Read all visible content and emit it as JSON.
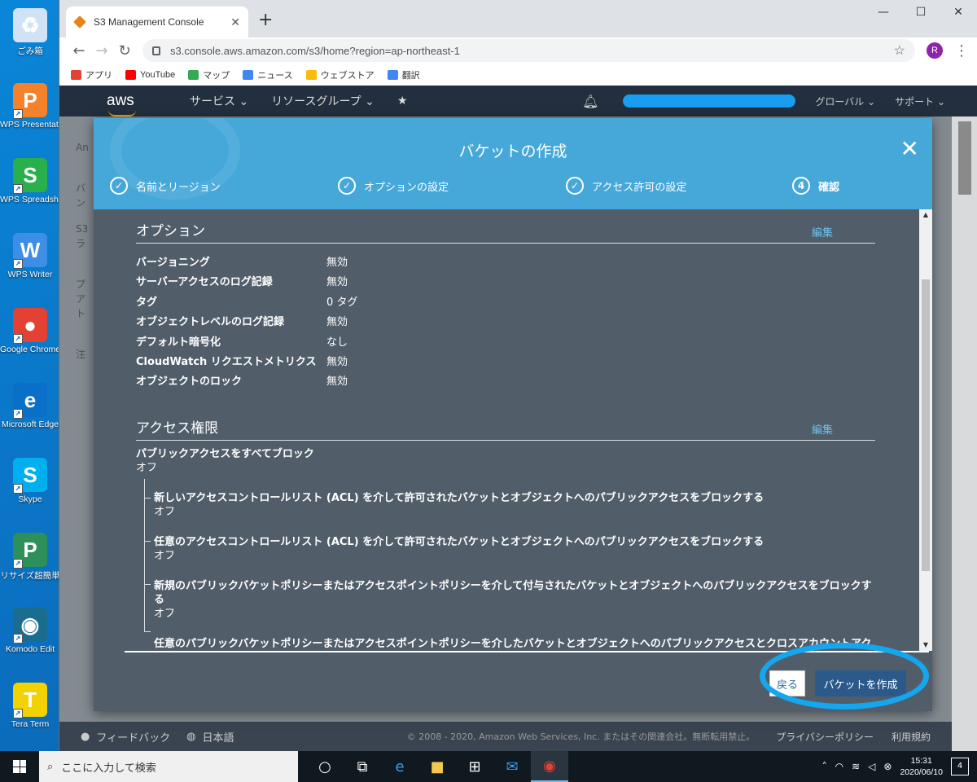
{
  "desktop": {
    "icons": [
      {
        "label": "ごみ箱",
        "glyph": "♻",
        "color": "#cfe3f5"
      },
      {
        "label": "WPS Presentati",
        "glyph": "P",
        "color": "#f4822a"
      },
      {
        "label": "WPS Spreadshe",
        "glyph": "S",
        "color": "#27b04b"
      },
      {
        "label": "WPS Writer",
        "glyph": "W",
        "color": "#3c8ee6"
      },
      {
        "label": "Google Chrome",
        "glyph": "●",
        "color": "#e34133"
      },
      {
        "label": "Microsoft Edge",
        "glyph": "e",
        "color": "#0a6fc9"
      },
      {
        "label": "Skype",
        "glyph": "S",
        "color": "#00aff0"
      },
      {
        "label": "リサイズ超簡単",
        "glyph": "P",
        "color": "#2d8f5a"
      },
      {
        "label": "Komodo Edit",
        "glyph": "◉",
        "color": "#1b6d8f"
      },
      {
        "label": "Tera Term",
        "glyph": "T",
        "color": "#f2d200"
      }
    ]
  },
  "browser": {
    "tab_title": "S3 Management Console",
    "url": "s3.console.aws.amazon.com/s3/home?region=ap-northeast-1",
    "avatar_letter": "R",
    "bookmarks": [
      {
        "label": "アプリ",
        "color": "#e34133"
      },
      {
        "label": "YouTube",
        "color": "#ff0000"
      },
      {
        "label": "マップ",
        "color": "#34a853"
      },
      {
        "label": "ニュース",
        "color": "#4285f4"
      },
      {
        "label": "ウェブストア",
        "color": "#fbbc05"
      },
      {
        "label": "翻訳",
        "color": "#4285f4"
      }
    ]
  },
  "aws": {
    "logo": "aws",
    "menu": {
      "services": "サービス ⌄",
      "resource_groups": "リソースグループ ⌄"
    },
    "region": "グローバル ⌄",
    "support": "サポート ⌄",
    "left_fragments": [
      "An",
      "バ",
      "ン",
      "S3",
      "ラ",
      "プ",
      "ア",
      "ト",
      "注"
    ]
  },
  "modal": {
    "title": "バケットの作成",
    "steps": [
      {
        "marker": "✓",
        "label": "名前とリージョン"
      },
      {
        "marker": "✓",
        "label": "オプションの設定"
      },
      {
        "marker": "✓",
        "label": "アクセス許可の設定"
      },
      {
        "marker": "4",
        "label": "確認"
      }
    ],
    "options": {
      "heading": "オプション",
      "edit": "編集",
      "rows": [
        {
          "key": "バージョニング",
          "value": "無効"
        },
        {
          "key": "サーバーアクセスのログ記録",
          "value": "無効"
        },
        {
          "key": "タグ",
          "value": "0 タグ"
        },
        {
          "key": "オブジェクトレベルのログ記録",
          "value": "無効"
        },
        {
          "key": "デフォルト暗号化",
          "value": "なし"
        },
        {
          "key": "CloudWatch リクエストメトリクス",
          "value": "無効"
        },
        {
          "key": "オブジェクトのロック",
          "value": "無効"
        }
      ]
    },
    "access": {
      "heading": "アクセス権限",
      "edit": "編集",
      "block_all": "パブリックアクセスをすべてブロック",
      "block_all_value": "オフ",
      "items": [
        {
          "q": "新しいアクセスコントロールリスト (ACL) を介して許可されたバケットとオブジェクトへのパブリックアクセスをブロックする",
          "v": "オフ"
        },
        {
          "q": "任意のアクセスコントロールリスト (ACL) を介して許可されたバケットとオブジェクトへのパブリックアクセスをブロックする",
          "v": "オフ"
        },
        {
          "q": "新規のパブリックバケットポリシーまたはアクセスポイントポリシーを介して付与されたバケットとオブジェクトへのパブリックアクセスをブロックする",
          "v": "オフ"
        },
        {
          "q": "任意のパブリックバケットポリシーまたはアクセスポイントポリシーを介したバケットとオブジェクトへのパブリックアクセスとクロスアカウントアク",
          "v": ""
        }
      ]
    },
    "back": "戻る",
    "create": "バケットを作成"
  },
  "footer": {
    "feedback": "フィードバック",
    "language": "日本語",
    "copyright": "© 2008 - 2020, Amazon Web Services, Inc. またはその関連会社。無断転用禁止。",
    "privacy": "プライバシーポリシー",
    "terms": "利用規約"
  },
  "taskbar": {
    "search_placeholder": "ここに入力して検索",
    "time": "15:31",
    "date": "2020/06/10",
    "notifications": "4"
  }
}
